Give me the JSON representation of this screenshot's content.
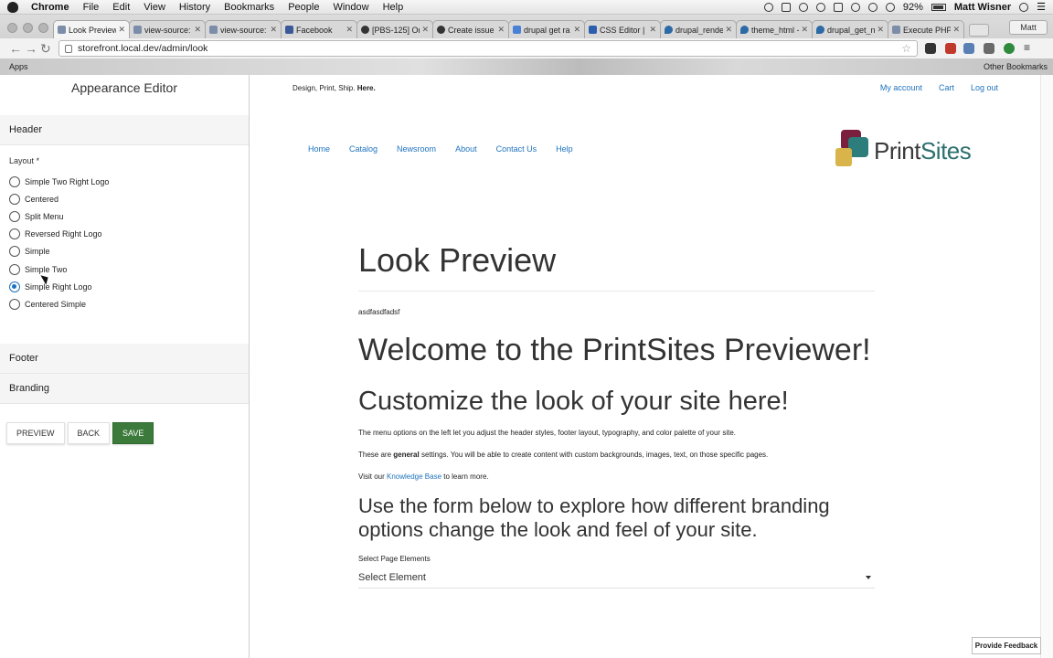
{
  "menubar": {
    "items": [
      "Chrome",
      "File",
      "Edit",
      "View",
      "History",
      "Bookmarks",
      "People",
      "Window",
      "Help"
    ],
    "battery": "92%",
    "user": "Matt Wisner"
  },
  "browser": {
    "tabs": [
      {
        "label": "Look Preview",
        "fav": "doc"
      },
      {
        "label": "view-source:",
        "fav": "doc"
      },
      {
        "label": "view-source:",
        "fav": "doc"
      },
      {
        "label": "Facebook",
        "fav": "fb"
      },
      {
        "label": "[PBS-125] Or",
        "fav": "gh"
      },
      {
        "label": "Create issue",
        "fav": "gh"
      },
      {
        "label": "drupal get ra",
        "fav": "g"
      },
      {
        "label": "CSS Editor | C",
        "fav": "css"
      },
      {
        "label": "drupal_rende",
        "fav": "dr"
      },
      {
        "label": "theme_html -",
        "fav": "dr"
      },
      {
        "label": "drupal_get_n",
        "fav": "dr"
      },
      {
        "label": "Execute PHP",
        "fav": "doc"
      }
    ],
    "profile": "Matt",
    "url": "storefront.local.dev/admin/look",
    "bookmarks": {
      "apps": "Apps",
      "other": "Other Bookmarks"
    }
  },
  "editor": {
    "title": "Appearance Editor",
    "header_section": "Header",
    "layout_label": "Layout *",
    "layouts": [
      {
        "label": "Simple Two Right Logo",
        "selected": false
      },
      {
        "label": "Centered",
        "selected": false
      },
      {
        "label": "Split Menu",
        "selected": false
      },
      {
        "label": "Reversed Right Logo",
        "selected": false
      },
      {
        "label": "Simple",
        "selected": false
      },
      {
        "label": "Simple Two",
        "selected": false
      },
      {
        "label": "Simple Right Logo",
        "selected": true
      },
      {
        "label": "Centered Simple",
        "selected": false
      }
    ],
    "footer_section": "Footer",
    "branding_section": "Branding",
    "buttons": {
      "preview": "PREVIEW",
      "back": "BACK",
      "save": "SAVE"
    }
  },
  "preview": {
    "tagline_prefix": "Design, Print, Ship.",
    "tagline_bold": "Here.",
    "toplinks": [
      "My account",
      "Cart",
      "Log out"
    ],
    "nav": [
      "Home",
      "Catalog",
      "Newsroom",
      "About",
      "Contact Us",
      "Help"
    ],
    "logo_a": "Print",
    "logo_b": "Sites",
    "page_title": "Look Preview",
    "body_text": "asdfasdfadsf",
    "welcome": "Welcome to the PrintSites Previewer!",
    "customize": "Customize the look of your site here!",
    "p1": "The menu options on the left let you adjust the header styles, footer layout, typography, and color palette of your site.",
    "p2_a": "These are ",
    "p2_b": "general",
    "p2_c": " settings. You will be able to create content with custom backgrounds, images, text, on those specific pages.",
    "p3_a": "Visit our ",
    "p3_link": "Knowledge Base",
    "p3_b": " to learn more.",
    "form_heading": "Use the form below to explore how different branding options change the look and feel of your site.",
    "select_label": "Select Page Elements",
    "select_value": "Select Element"
  },
  "feedback": "Provide Feedback",
  "colors": {
    "accent": "#1e73be",
    "save": "#3c7a3c",
    "logo_teal": "#2d6f6f"
  }
}
